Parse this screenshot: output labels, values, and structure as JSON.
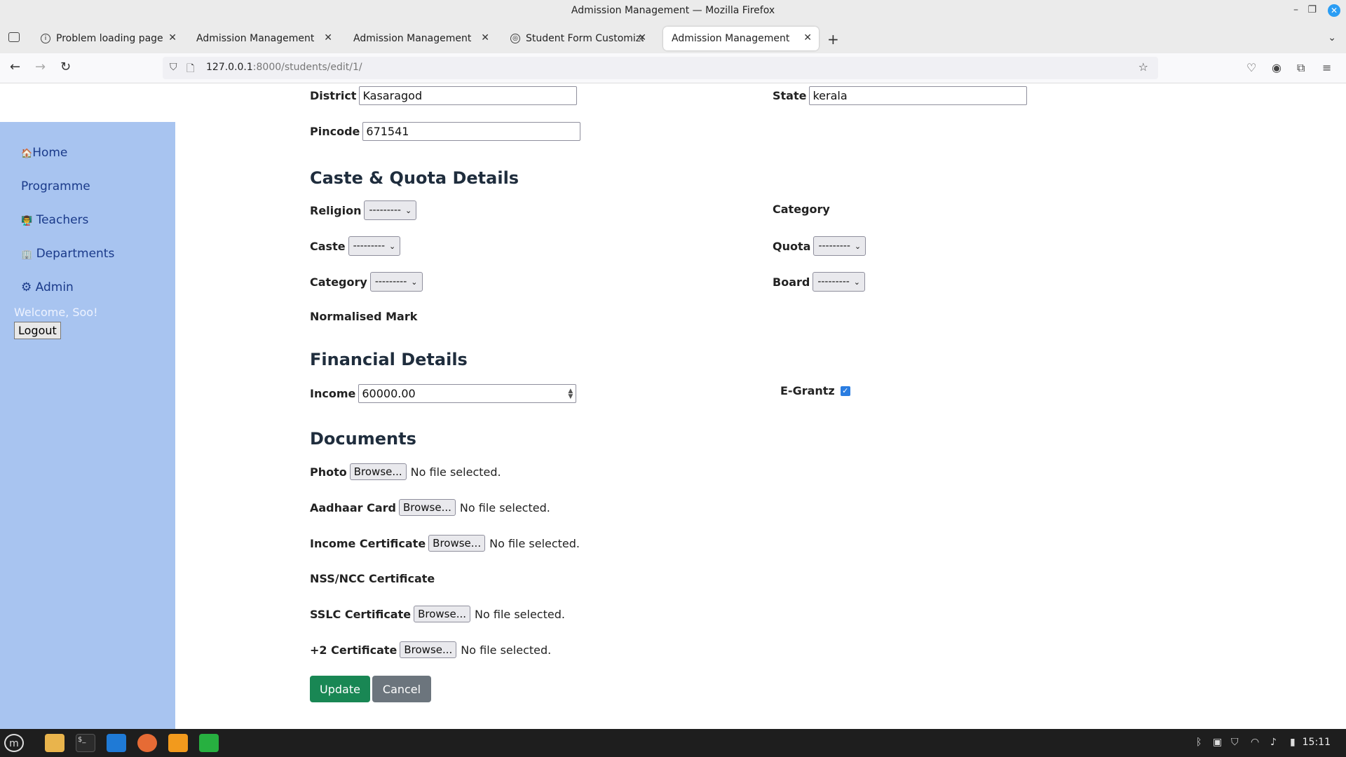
{
  "window": {
    "title": "Admission Management — Mozilla Firefox"
  },
  "tabs": [
    {
      "label": "Problem loading page"
    },
    {
      "label": "Admission Management"
    },
    {
      "label": "Admission Management"
    },
    {
      "label": "Student Form Customizatio"
    },
    {
      "label": "Admission Management"
    }
  ],
  "urlbar": {
    "host": "127.0.0.1",
    "path": ":8000/students/edit/1/"
  },
  "sidebar": {
    "items": [
      {
        "icon": "🏠",
        "label": "Home"
      },
      {
        "icon": "",
        "label": "Programme"
      },
      {
        "icon": "👨‍🏫",
        "label": "Teachers"
      },
      {
        "icon": "🏢",
        "label": "Departments"
      },
      {
        "icon": "⚙",
        "label": "Admin"
      }
    ],
    "welcome": "Welcome, Soo!",
    "logout": "Logout"
  },
  "address": {
    "district_label": "District",
    "district_value": "Kasaragod",
    "state_label": "State",
    "state_value": "kerala",
    "pincode_label": "Pincode",
    "pincode_value": "671541"
  },
  "caste": {
    "heading": "Caste & Quota Details",
    "religion_label": "Religion",
    "religion_value": "---------",
    "category_label_right": "Category",
    "caste_label": "Caste",
    "caste_value": "---------",
    "quota_label": "Quota",
    "quota_value": "---------",
    "category_label": "Category",
    "category_value": "---------",
    "board_label": "Board",
    "board_value": "---------",
    "normalised_label": "Normalised Mark"
  },
  "financial": {
    "heading": "Financial Details",
    "income_label": "Income",
    "income_value": "60000.00",
    "egrantz_label": "E-Grantz",
    "egrantz_checked": true
  },
  "documents": {
    "heading": "Documents",
    "browse_label": "Browse...",
    "no_file": "No file selected.",
    "photo_label": "Photo",
    "aadhaar_label": "Aadhaar Card",
    "income_cert_label": "Income Certificate",
    "nss_label": "NSS/NCC Certificate",
    "sslc_label": "SSLC Certificate",
    "plus2_label": "+2 Certificate"
  },
  "actions": {
    "update": "Update",
    "cancel": "Cancel"
  },
  "taskbar": {
    "time": "15:11"
  },
  "colors": {
    "sidebar": "#a8c4f0",
    "update": "#198754",
    "cancel": "#6c757d"
  }
}
